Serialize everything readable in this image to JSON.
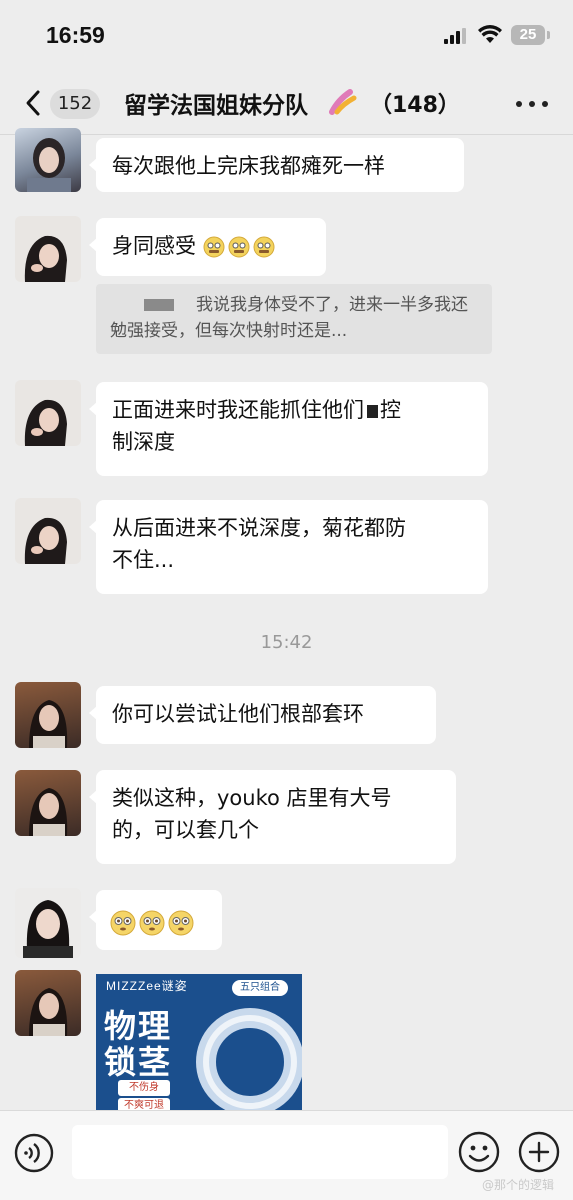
{
  "status_bar": {
    "time": "16:59",
    "battery": "25"
  },
  "nav": {
    "unread_count": "152",
    "title": "留学法国姐妹分队",
    "member_count": "（148）"
  },
  "messages": [
    {
      "text": "每次跟他上完床我都瘫死一样"
    },
    {
      "text": "身同感受"
    },
    {
      "quote": "我说我身体受不了，进来一半多我还勉强接受，但每次快射时还是..."
    },
    {
      "line1": "正面进来时我还能抓住他们",
      "line2": "控",
      "line3": "制深度"
    },
    {
      "line1": "从后面进来不说深度，菊花都防",
      "line2": "不住..."
    },
    {
      "timestamp": "15:42"
    },
    {
      "text": "你可以尝试让他们根部套环"
    },
    {
      "line1": "类似这种，youko 店里有大号",
      "line2": "的，可以套几个"
    }
  ],
  "product_card": {
    "brand": "MIZZZee谜姿",
    "tag": "五只组合",
    "title_line1": "物理",
    "title_line2": "锁茎",
    "note1": "不伤身",
    "note2": "不爽可退"
  },
  "input_bar": {
    "placeholder": ""
  },
  "watermark": "@那个的逻辑",
  "colors": {
    "bubble": "#ffffff",
    "background": "#ededed",
    "accent": "#1b4f8d"
  }
}
